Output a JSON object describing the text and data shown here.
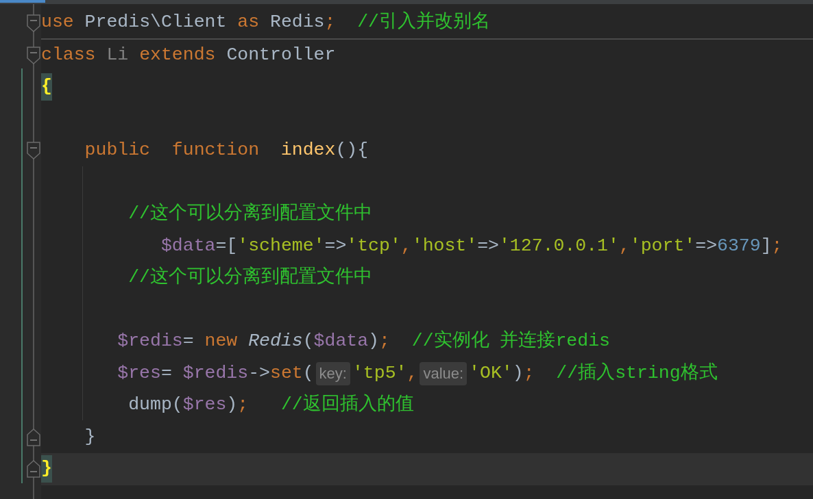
{
  "lines": [
    {
      "fold_start": true,
      "separator_after": true,
      "tokens": [
        {
          "kind": "keyword",
          "text": "use"
        },
        {
          "kind": "plain",
          "text": " Predis\\Client "
        },
        {
          "kind": "keyword",
          "text": "as"
        },
        {
          "kind": "plain",
          "text": " Redis"
        },
        {
          "kind": "punct",
          "text": ";  "
        },
        {
          "kind": "comment",
          "text": "//引入并改别名"
        }
      ]
    },
    {
      "fold_start": true,
      "tokens": [
        {
          "kind": "keyword",
          "text": "class "
        },
        {
          "kind": "classref",
          "text": "Li "
        },
        {
          "kind": "keyword",
          "text": "extends "
        },
        {
          "kind": "plain",
          "text": "Controller"
        }
      ]
    },
    {
      "blank_after": true,
      "tokens": [
        {
          "kind": "brace",
          "text": "{"
        }
      ]
    },
    {
      "fold_start": true,
      "blank_after": true,
      "tokens": [
        {
          "kind": "keyword",
          "text": "    public  function  "
        },
        {
          "kind": "function",
          "text": "index"
        },
        {
          "kind": "plain",
          "text": "(){"
        }
      ]
    },
    {
      "tokens": [
        {
          "kind": "comment",
          "text": "        //这个可以分离到配置文件中"
        }
      ]
    },
    {
      "tokens": [
        {
          "kind": "variable",
          "text": "           $data"
        },
        {
          "kind": "plain",
          "text": "=["
        },
        {
          "kind": "string",
          "text": "'scheme'"
        },
        {
          "kind": "plain",
          "text": "=>"
        },
        {
          "kind": "string",
          "text": "'tcp'"
        },
        {
          "kind": "punct",
          "text": ","
        },
        {
          "kind": "string",
          "text": "'host'"
        },
        {
          "kind": "plain",
          "text": "=>"
        },
        {
          "kind": "string",
          "text": "'127.0.0.1'"
        },
        {
          "kind": "punct",
          "text": ","
        },
        {
          "kind": "string",
          "text": "'port'"
        },
        {
          "kind": "plain",
          "text": "=>"
        },
        {
          "kind": "number",
          "text": "6379"
        },
        {
          "kind": "plain",
          "text": "]"
        },
        {
          "kind": "punct",
          "text": ";"
        }
      ]
    },
    {
      "blank_after": true,
      "tokens": [
        {
          "kind": "comment",
          "text": "        //这个可以分离到配置文件中"
        }
      ]
    },
    {
      "tokens": [
        {
          "kind": "variable",
          "text": "       $redis"
        },
        {
          "kind": "plain",
          "text": "= "
        },
        {
          "kind": "keyword",
          "text": "new "
        },
        {
          "kind": "classitalic",
          "text": "Redis"
        },
        {
          "kind": "plain",
          "text": "("
        },
        {
          "kind": "variable",
          "text": "$data"
        },
        {
          "kind": "plain",
          "text": ")"
        },
        {
          "kind": "punct",
          "text": ";  "
        },
        {
          "kind": "comment",
          "text": "//实例化 并连接redis"
        }
      ]
    },
    {
      "tokens": [
        {
          "kind": "variable",
          "text": "       $res"
        },
        {
          "kind": "plain",
          "text": "= "
        },
        {
          "kind": "variable",
          "text": "$redis"
        },
        {
          "kind": "plain",
          "text": "->"
        },
        {
          "kind": "method",
          "text": "set"
        },
        {
          "kind": "plain",
          "text": "("
        },
        {
          "kind": "hint",
          "text": "key:"
        },
        {
          "kind": "string",
          "text": "'tp5'"
        },
        {
          "kind": "punct",
          "text": ","
        },
        {
          "kind": "hint",
          "text": "value:"
        },
        {
          "kind": "string",
          "text": "'OK'"
        },
        {
          "kind": "plain",
          "text": ")"
        },
        {
          "kind": "punct",
          "text": ";  "
        },
        {
          "kind": "comment",
          "text": "//插入string格式"
        }
      ]
    },
    {
      "tokens": [
        {
          "kind": "plain",
          "text": "        dump("
        },
        {
          "kind": "variable",
          "text": "$res"
        },
        {
          "kind": "plain",
          "text": ")"
        },
        {
          "kind": "punct",
          "text": ";   "
        },
        {
          "kind": "comment",
          "text": "//返回插入的值"
        }
      ]
    },
    {
      "fold_end": true,
      "tokens": [
        {
          "kind": "plain",
          "text": "    }"
        }
      ]
    },
    {
      "fold_end": true,
      "current": true,
      "tokens": [
        {
          "kind": "brace",
          "text": "}"
        }
      ]
    }
  ]
}
